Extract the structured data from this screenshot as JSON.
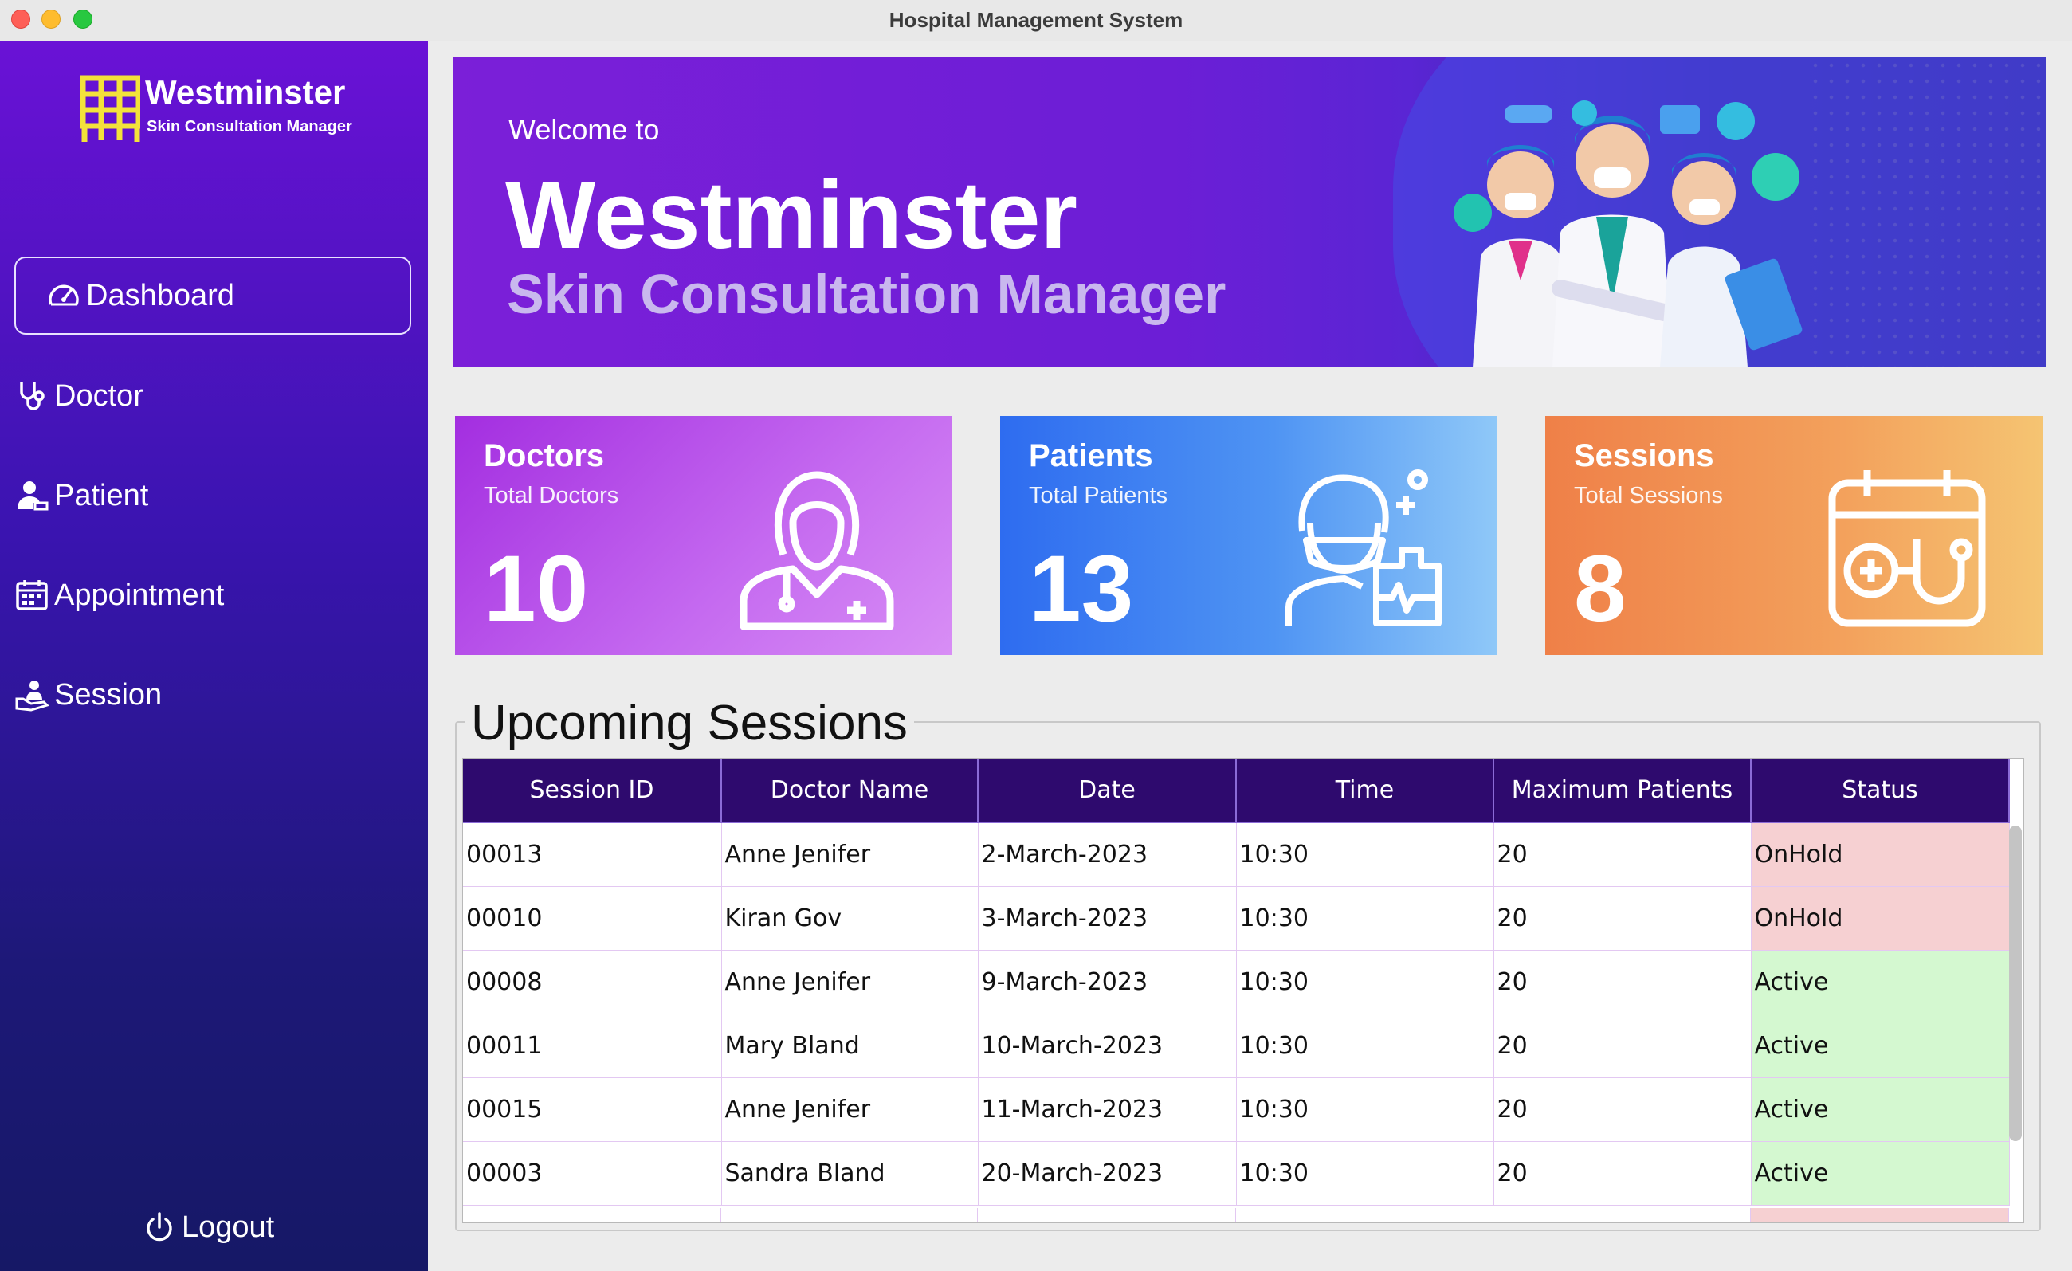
{
  "window": {
    "title": "Hospital Management System"
  },
  "logo": {
    "title": "Westminster",
    "subtitle": "Skin Consultation Manager"
  },
  "sidebar": {
    "items": [
      {
        "label": "Dashboard",
        "icon": "dashboard-gauge-icon",
        "active": true
      },
      {
        "label": "Doctor",
        "icon": "stethoscope-icon",
        "active": false
      },
      {
        "label": "Patient",
        "icon": "patient-icon",
        "active": false
      },
      {
        "label": "Appointment",
        "icon": "calendar-icon",
        "active": false
      },
      {
        "label": "Session",
        "icon": "session-icon",
        "active": false
      }
    ],
    "logout": "Logout"
  },
  "banner": {
    "welcome": "Welcome to",
    "title": "Westminster",
    "subtitle": "Skin Consultation Manager"
  },
  "stats": {
    "doctors": {
      "title": "Doctors",
      "subtitle": "Total Doctors",
      "value": "10",
      "icon": "female-doctor-icon"
    },
    "patients": {
      "title": "Patients",
      "subtitle": "Total Patients",
      "value": "13",
      "icon": "masked-patient-icon"
    },
    "sessions": {
      "title": "Sessions",
      "subtitle": "Total Sessions",
      "value": "8",
      "icon": "calendar-stethoscope-icon"
    }
  },
  "upcoming": {
    "title": "Upcoming Sessions",
    "columns": [
      "Session ID",
      "Doctor Name",
      "Date",
      "Time",
      "Maximum Patients",
      "Status"
    ],
    "rows": [
      [
        "00013",
        "Anne Jenifer",
        "2-March-2023",
        "10:30",
        "20",
        "OnHold"
      ],
      [
        "00010",
        "Kiran Gov",
        "3-March-2023",
        "10:30",
        "20",
        "OnHold"
      ],
      [
        "00008",
        "Anne Jenifer",
        "9-March-2023",
        "10:30",
        "20",
        "Active"
      ],
      [
        "00011",
        "Mary Bland",
        "10-March-2023",
        "10:30",
        "20",
        "Active"
      ],
      [
        "00015",
        "Anne Jenifer",
        "11-March-2023",
        "10:30",
        "20",
        "Active"
      ],
      [
        "00003",
        "Sandra Bland",
        "20-March-2023",
        "10:30",
        "20",
        "Active"
      ]
    ]
  },
  "colors": {
    "sidebar_top": "#6a12d6",
    "sidebar_bottom": "#161866",
    "table_header": "#2e0a6e",
    "status_onhold": "#f6d0d2",
    "status_active": "#d4f8d0",
    "logo_accent": "#f3e23a"
  }
}
